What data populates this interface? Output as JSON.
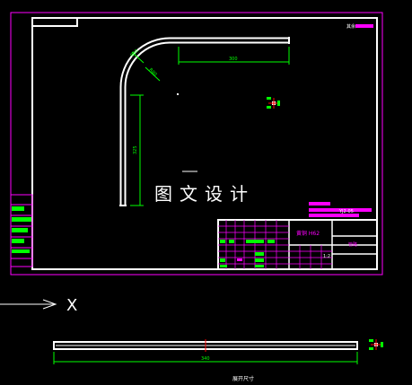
{
  "drawing": {
    "watermark": "图文设计",
    "corner_note": "其余",
    "view_label": "展开尺寸",
    "axis_label": "X",
    "dims": {
      "straight_top": "300",
      "vertical": "325",
      "bend_a": "R50",
      "bend_b": "R80",
      "flat_length": "340"
    },
    "title_block": {
      "material": "黄铜 H62",
      "scale": "1:2",
      "drawing_no": "YJ2-05",
      "part_name": "管路"
    }
  },
  "colors": {
    "background": "#000000",
    "border": "#ff00ff",
    "outline": "#ffffff",
    "dimension": "#00ff00",
    "centerline": "#ff0000"
  }
}
